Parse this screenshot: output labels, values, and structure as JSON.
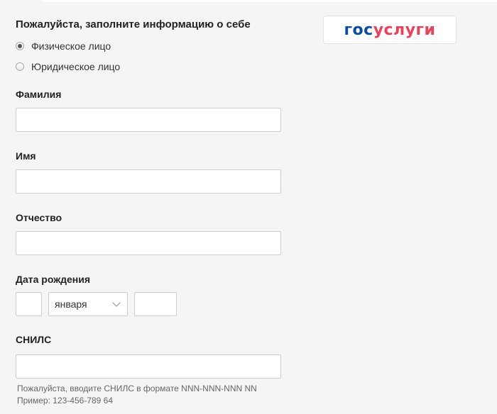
{
  "heading": "Пожалуйста, заполните информацию о себе",
  "person_type": {
    "options": [
      {
        "label": "Физическое лицо",
        "checked": true
      },
      {
        "label": "Юридическое лицо",
        "checked": false
      }
    ]
  },
  "fields": {
    "last_name": {
      "label": "Фамилия",
      "value": ""
    },
    "first_name": {
      "label": "Имя",
      "value": ""
    },
    "middle_name": {
      "label": "Отчество",
      "value": ""
    },
    "birth_date": {
      "label": "Дата рождения",
      "day": "",
      "month": "января",
      "year": ""
    },
    "snils": {
      "label": "СНИЛС",
      "value": "",
      "hint_line1": "Пожалуйста, вводите СНИЛС в формате NNN-NNN-NNN NN",
      "hint_line2": "Пример: 123-456-789 64"
    }
  },
  "logo": {
    "part1": "гос",
    "part2": "услуги",
    "color_primary": "#0d4ca3",
    "color_accent": "#ee3f58"
  }
}
